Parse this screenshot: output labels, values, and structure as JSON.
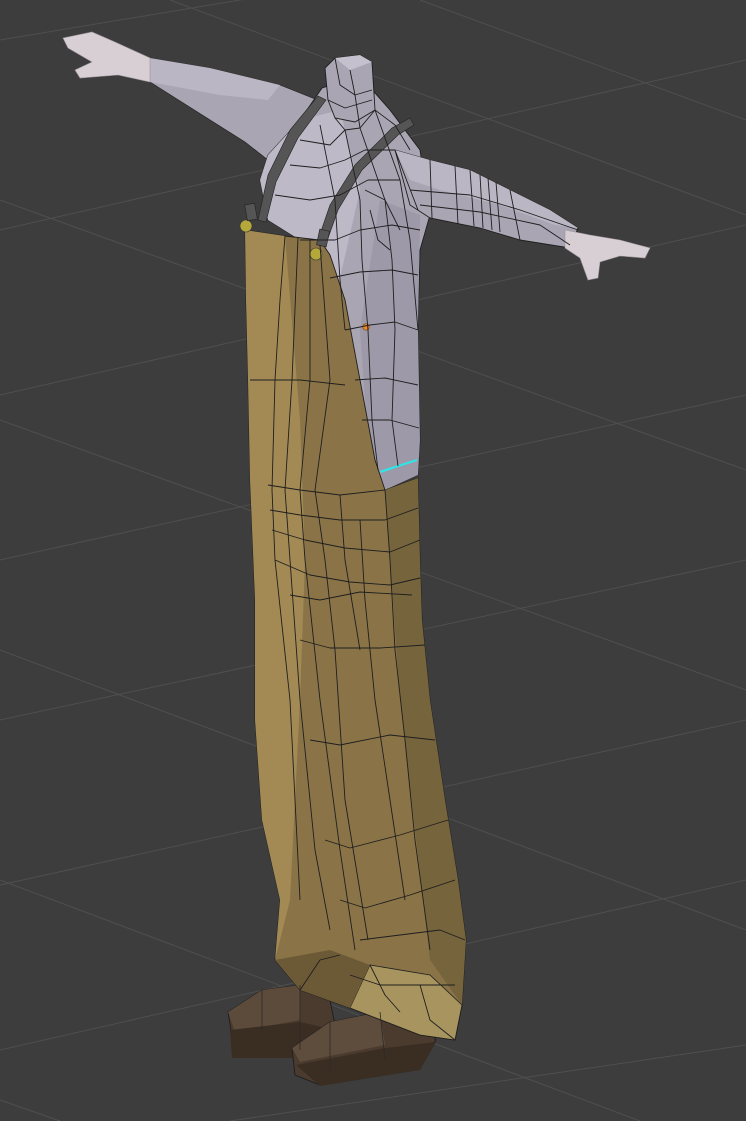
{
  "viewport": {
    "background": "#3d3d3d",
    "grid_color": "#4f4f4f",
    "view": "3d-viewport-perspective",
    "shading": "solid-with-wireframe-overlay"
  },
  "model": {
    "description_icon": "t-pose-character-mesh",
    "colors": {
      "shirt": "#a9a5b3",
      "shirt_shadow": "#8f8b99",
      "skin": "#d8cfd4",
      "overalls": "#8a7447",
      "overalls_light": "#a38a55",
      "overalls_dark": "#6c5a36",
      "straps": "#555555",
      "buttons": "#b5a83a",
      "shoes": "#4a3b2e",
      "shoes_light": "#6a584a",
      "wire": "#1e1e1e",
      "selected_edge": "#2ee6e6",
      "origin": "#f08a24"
    }
  }
}
